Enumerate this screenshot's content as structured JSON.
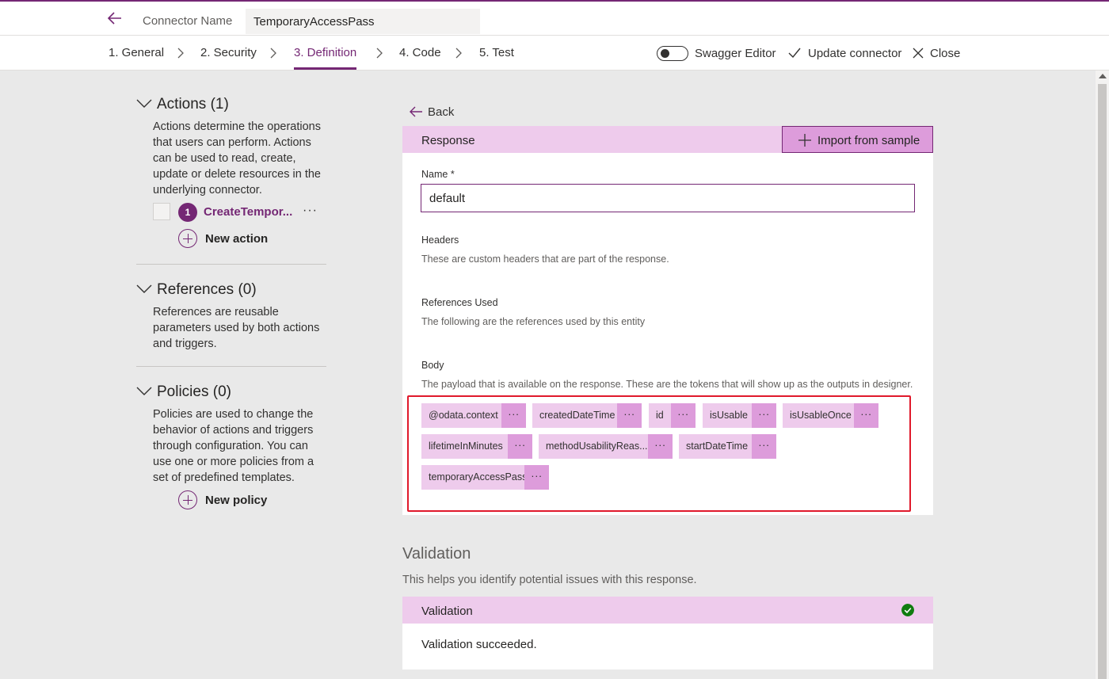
{
  "header": {
    "connector_name_label": "Connector Name",
    "connector_name_value": "TemporaryAccessPass"
  },
  "steps": [
    {
      "label": "1. General"
    },
    {
      "label": "2. Security"
    },
    {
      "label": "3. Definition",
      "active": true
    },
    {
      "label": "4. Code"
    },
    {
      "label": "5. Test"
    }
  ],
  "toolbar": {
    "swagger_label": "Swagger Editor",
    "swagger_on": false,
    "update_label": "Update connector",
    "close_label": "Close"
  },
  "sidebar": {
    "actions": {
      "title": "Actions (1)",
      "desc": "Actions determine the operations that users can perform. Actions can be used to read, create, update or delete resources in the underlying connector.",
      "items": [
        {
          "number": "1",
          "name": "CreateTempor..."
        }
      ],
      "more": "···",
      "new_label": "New action"
    },
    "references": {
      "title": "References (0)",
      "desc": "References are reusable parameters used by both actions and triggers."
    },
    "policies": {
      "title": "Policies (0)",
      "desc": "Policies are used to change the behavior of actions and triggers through configuration. You can use one or more policies from a set of predefined templates.",
      "new_label": "New policy"
    }
  },
  "main": {
    "back_label": "Back",
    "response": {
      "title": "Response",
      "import_label": "Import from sample",
      "name_label": "Name *",
      "name_value": "default",
      "headers_label": "Headers",
      "headers_help": "These are custom headers that are part of the response.",
      "refs_label": "References Used",
      "refs_help": "The following are the references used by this entity",
      "body_label": "Body",
      "body_help": "The payload that is available on the response. These are the tokens that will show up as the outputs in designer.",
      "tokens": [
        {
          "label": "@odata.context"
        },
        {
          "label": "createdDateTime"
        },
        {
          "label": "id"
        },
        {
          "label": "isUsable"
        },
        {
          "label": "isUsableOnce"
        },
        {
          "label": "lifetimeInMinutes"
        },
        {
          "label": "methodUsabilityReas..."
        },
        {
          "label": "startDateTime"
        },
        {
          "label": "temporaryAccessPass"
        }
      ],
      "token_more": "···"
    },
    "validation": {
      "title": "Validation",
      "help": "This helps you identify potential issues with this response.",
      "card_title": "Validation",
      "status_icon": "check-circle-icon",
      "message": "Validation succeeded."
    }
  },
  "colors": {
    "accent": "#742774",
    "token_bg": "#eecbec",
    "token_more_bg": "#dd9cdb",
    "highlight_border": "#e0192b",
    "success": "#107c10"
  }
}
